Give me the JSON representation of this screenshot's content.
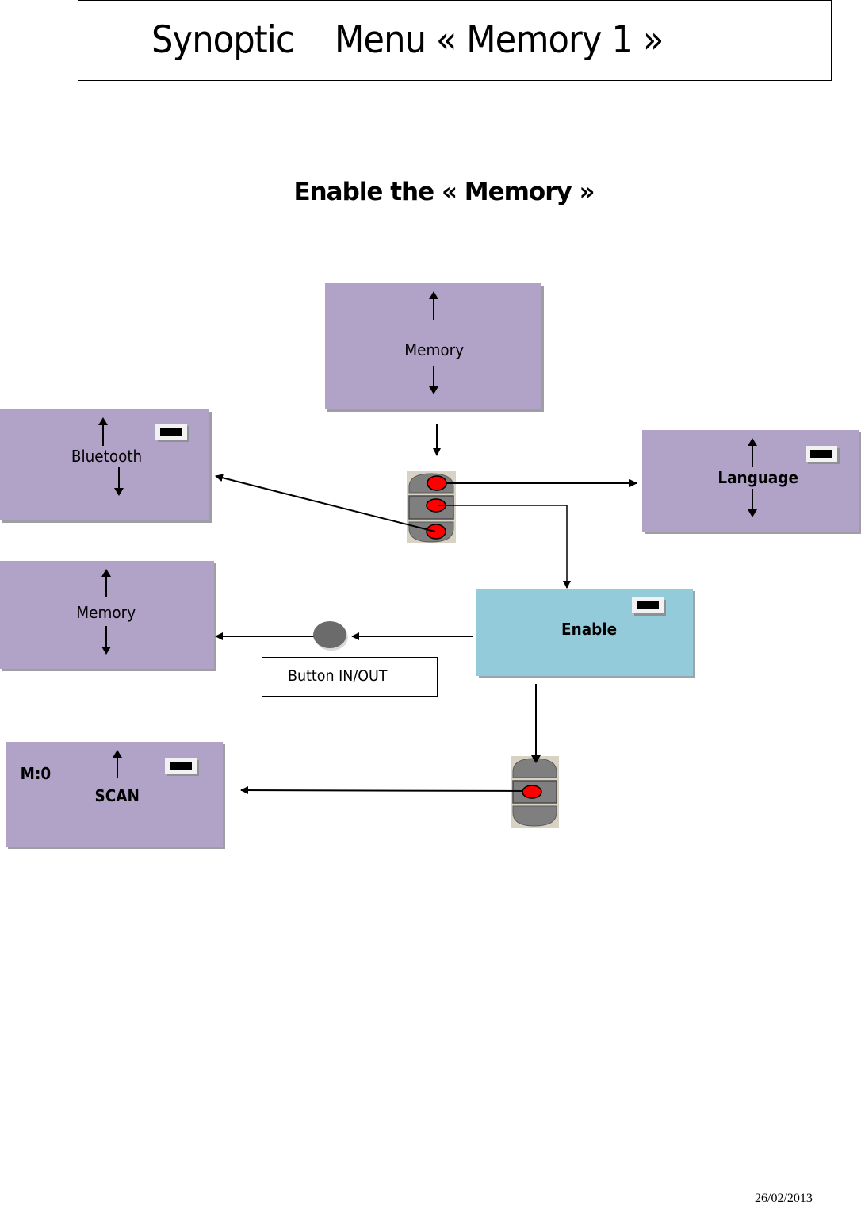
{
  "header": {
    "title": "Synoptic    Menu « Memory 1 »"
  },
  "subtitle": "Enable the « Memory »",
  "screens": {
    "memory_top": {
      "label": "Memory",
      "arrows": [
        "up",
        "down"
      ],
      "battery": false
    },
    "bluetooth": {
      "label": "Bluetooth",
      "arrows": [
        "up",
        "down"
      ],
      "battery": true
    },
    "language": {
      "label": "Language",
      "arrows": [
        "up",
        "down"
      ],
      "battery": true
    },
    "memory_left": {
      "label": "Memory",
      "arrows": [
        "up",
        "down"
      ],
      "battery": false
    },
    "enable": {
      "label": "Enable",
      "arrows": [],
      "battery": true
    },
    "scan": {
      "label": "SCAN",
      "counter": "M:0",
      "arrows": [
        "up"
      ],
      "battery": true
    }
  },
  "button_in_out": {
    "label": "Button IN/OUT"
  },
  "keypads": {
    "keypad_1": {
      "active_buttons": [
        "top",
        "middle",
        "bottom"
      ]
    },
    "keypad_2": {
      "active_buttons": [
        "middle"
      ]
    }
  },
  "colors": {
    "screen_purple": "#b1a2c8",
    "screen_blue": "#93cbdb",
    "button_red": "#ff0000",
    "keypad_gray": "#7f7f7f"
  },
  "footer": {
    "date": "26/02/2013"
  }
}
